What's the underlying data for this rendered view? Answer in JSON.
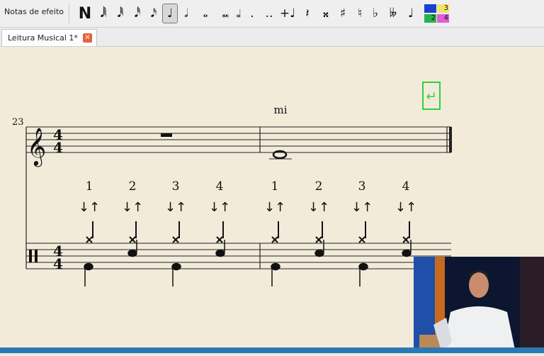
{
  "toolbar": {
    "label": "Notas de efeito",
    "buttons": [
      {
        "name": "note-input-toggle-button",
        "glyph": "N"
      },
      {
        "name": "duration-128th-button",
        "glyph": "𝅘𝅥𝅲"
      },
      {
        "name": "duration-64th-button",
        "glyph": "𝅘𝅥𝅱"
      },
      {
        "name": "duration-32nd-button",
        "glyph": "𝅘𝅥𝅰"
      },
      {
        "name": "duration-16th-button",
        "glyph": "𝅘𝅥𝅯"
      },
      {
        "name": "duration-quarter-button",
        "glyph": "♩"
      },
      {
        "name": "duration-half-button",
        "glyph": "𝅗𝅥"
      },
      {
        "name": "duration-whole-button",
        "glyph": "𝅝"
      },
      {
        "name": "duration-breve-button",
        "glyph": "𝅜"
      },
      {
        "name": "duration-longa-button",
        "glyph": "𝆷"
      },
      {
        "name": "dot-button",
        "glyph": "."
      },
      {
        "name": "double-dot-button",
        "glyph": ".."
      },
      {
        "name": "tie-button",
        "glyph": "+♩"
      },
      {
        "name": "rest-button",
        "glyph": "𝄽"
      },
      {
        "name": "double-sharp-button",
        "glyph": "𝄪"
      },
      {
        "name": "sharp-button",
        "glyph": "♯"
      },
      {
        "name": "natural-button",
        "glyph": "♮"
      },
      {
        "name": "flat-button",
        "glyph": "♭"
      },
      {
        "name": "double-flat-button",
        "glyph": "𝄫"
      },
      {
        "name": "flip-direction-button",
        "glyph": "♩"
      }
    ],
    "voices": [
      "1",
      "3",
      "2",
      "4"
    ],
    "voice_colors": [
      "#1a3fd1",
      "#f0e46a",
      "#27b14c",
      "#e35bd5"
    ]
  },
  "tab": {
    "label": "Leitura Musical 1*",
    "close_glyph": "✕"
  },
  "score": {
    "measure_number": "23",
    "time_sig_top": "4",
    "time_sig_bottom": "4",
    "lyric": "mi",
    "counts": [
      "1",
      "2",
      "3",
      "4",
      "1",
      "2",
      "3",
      "4"
    ],
    "strum": "↓↑",
    "return_icon_glyph": "↵"
  }
}
